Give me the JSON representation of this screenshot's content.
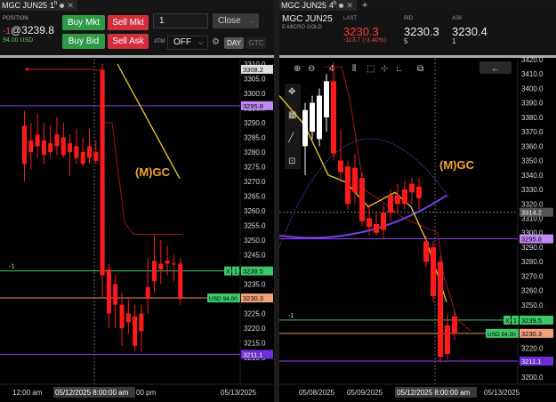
{
  "left": {
    "tab": {
      "symbol": "MGC JUN25",
      "interval": "1",
      "interval_unit": "h"
    },
    "position": {
      "label": "POSITION",
      "qty": "-1",
      "price": "@3239.8",
      "usd": "94.00 USD"
    },
    "buttons": {
      "buy_mkt": "Buy Mkt",
      "sell_mkt": "Sell Mkt",
      "buy_bid": "Buy Bid",
      "sell_ask": "Sell Ask",
      "close": "Close"
    },
    "quantity": "1",
    "atm_label": "ATM",
    "atm_value": "OFF",
    "tif_day": "DAY",
    "tif_gtc": "GTC",
    "watermark": "(M)GC",
    "price_ticks": [
      "3310.0",
      "3305.0",
      "3300.0",
      "3295.0",
      "3290.0",
      "3285.0",
      "3280.0",
      "3275.0",
      "3270.0",
      "3265.0",
      "3260.0",
      "3255.0",
      "3250.0",
      "3245.0",
      "3240.0",
      "3235.0",
      "3230.0",
      "3225.0",
      "3220.0",
      "3215.0",
      "3210.0"
    ],
    "tags": {
      "top_red": "3308.2",
      "purple_top": "3295.8",
      "green": "3239.5",
      "green_qty": "1",
      "green_x": "X",
      "orange": "3230.3",
      "usd_pl": "USD 94.00",
      "purple_bottom": "3211.1",
      "pos_marker": "-1"
    },
    "time_labels": {
      "start": "12:00 am",
      "cursor": "05/12/2025 8:00:00 am",
      "cursor_tail": "00 pm",
      "end": "05/13/2025"
    }
  },
  "right": {
    "tab": {
      "symbol": "MGC JUN25",
      "interval": "4",
      "interval_unit": "h"
    },
    "quote": {
      "symbol": "MGC JUN25",
      "description": "E-MICRO GOLD",
      "last_label": "LAST",
      "last": "3230.3",
      "change": "-113.7 (-3.40%)",
      "bid_label": "BID",
      "bid": "3230.3",
      "bid_size": "5",
      "ask_label": "ASK",
      "ask": "3230.4",
      "ask_size": "1"
    },
    "toolbar_interval": "4",
    "watermark": "(M)GC",
    "price_ticks": [
      "3420.0",
      "3410.0",
      "3400.0",
      "3390.0",
      "3380.0",
      "3370.0",
      "3360.0",
      "3350.0",
      "3340.0",
      "3330.0",
      "3320.0",
      "3310.0",
      "3300.0",
      "3290.0",
      "3280.0",
      "3270.0",
      "3260.0",
      "3250.0",
      "3240.0",
      "3230.0",
      "3220.0",
      "3210.0",
      "3200.0"
    ],
    "tags": {
      "gray": "3314.2",
      "purple_top": "3295.8",
      "green": "3239.5",
      "green_qty": "1",
      "green_x": "X",
      "orange": "3230.3",
      "usd_pl": "USD 94.00",
      "purple_bottom": "3211.1",
      "pos_marker": "-1"
    },
    "time_labels": {
      "d1": "05/08/2025",
      "d2": "05/09/2025",
      "cursor": "05/12/2025 8:00:00 am",
      "end": "05/13/2025"
    }
  },
  "colors": {
    "bear": "#ff1a1a",
    "bull": "#ffffff",
    "yellow_ma": "#f2d21b",
    "purple": "#8b3ff0",
    "green_line": "#3cc96a",
    "orange_line": "#f08a5d",
    "red_line": "#e84848"
  },
  "chart_data": [
    {
      "type": "candlestick",
      "title": "MGC JUN25 1h",
      "ylim": [
        3207,
        3312
      ],
      "candles": [
        {
          "o": 3289,
          "h": 3294,
          "l": 3270,
          "c": 3276
        },
        {
          "o": 3280,
          "h": 3290,
          "l": 3274,
          "c": 3284
        },
        {
          "o": 3286,
          "h": 3293,
          "l": 3278,
          "c": 3282
        },
        {
          "o": 3284,
          "h": 3290,
          "l": 3276,
          "c": 3279
        },
        {
          "o": 3283,
          "h": 3289,
          "l": 3278,
          "c": 3280
        },
        {
          "o": 3286,
          "h": 3292,
          "l": 3279,
          "c": 3282
        },
        {
          "o": 3285,
          "h": 3290,
          "l": 3278,
          "c": 3279
        },
        {
          "o": 3283,
          "h": 3286,
          "l": 3272,
          "c": 3280
        },
        {
          "o": 3282,
          "h": 3288,
          "l": 3276,
          "c": 3278
        },
        {
          "o": 3280,
          "h": 3285,
          "l": 3275,
          "c": 3276
        },
        {
          "o": 3282,
          "h": 3288,
          "l": 3276,
          "c": 3278
        },
        {
          "o": 3280,
          "h": 3284,
          "l": 3276,
          "c": 3277
        },
        {
          "o": 3308,
          "h": 3310,
          "l": 3230,
          "c": 3238
        },
        {
          "o": 3240,
          "h": 3242,
          "l": 3220,
          "c": 3225
        },
        {
          "o": 3235,
          "h": 3238,
          "l": 3220,
          "c": 3228
        },
        {
          "o": 3228,
          "h": 3232,
          "l": 3214,
          "c": 3220
        },
        {
          "o": 3225,
          "h": 3230,
          "l": 3218,
          "c": 3222
        },
        {
          "o": 3224,
          "h": 3228,
          "l": 3212,
          "c": 3214
        },
        {
          "o": 3219,
          "h": 3228,
          "l": 3212,
          "c": 3225
        },
        {
          "o": 3230,
          "h": 3244,
          "l": 3225,
          "c": 3234
        },
        {
          "o": 3236,
          "h": 3252,
          "l": 3232,
          "c": 3243
        },
        {
          "o": 3240,
          "h": 3250,
          "l": 3235,
          "c": 3242
        },
        {
          "o": 3243,
          "h": 3248,
          "l": 3238,
          "c": 3242
        },
        {
          "o": 3242,
          "h": 3245,
          "l": 3236,
          "c": 3242
        },
        {
          "o": 3242,
          "h": 3244,
          "l": 3228,
          "c": 3230
        }
      ],
      "levels": {
        "red_top": 3308.2,
        "purple_top": 3295.8,
        "green": 3239.5,
        "orange": 3230.3,
        "purple_bottom": 3211.1
      }
    },
    {
      "type": "candlestick",
      "title": "MGC JUN25 4h",
      "ylim": [
        3198,
        3422
      ],
      "candles": [
        {
          "o": 3360,
          "h": 3390,
          "l": 3340,
          "c": 3385,
          "bull": true
        },
        {
          "o": 3370,
          "h": 3395,
          "l": 3365,
          "c": 3390,
          "bull": true
        },
        {
          "o": 3365,
          "h": 3400,
          "l": 3360,
          "c": 3395,
          "bull": true
        },
        {
          "o": 3380,
          "h": 3410,
          "l": 3370,
          "c": 3405,
          "bull": true
        },
        {
          "o": 3405,
          "h": 3418,
          "l": 3350,
          "c": 3355
        },
        {
          "o": 3350,
          "h": 3372,
          "l": 3335,
          "c": 3342
        },
        {
          "o": 3346,
          "h": 3350,
          "l": 3316,
          "c": 3320
        },
        {
          "o": 3345,
          "h": 3355,
          "l": 3320,
          "c": 3328
        },
        {
          "o": 3338,
          "h": 3342,
          "l": 3305,
          "c": 3308
        },
        {
          "o": 3310,
          "h": 3320,
          "l": 3298,
          "c": 3304
        },
        {
          "o": 3306,
          "h": 3315,
          "l": 3298,
          "c": 3300
        },
        {
          "o": 3302,
          "h": 3320,
          "l": 3296,
          "c": 3314
        },
        {
          "o": 3314,
          "h": 3330,
          "l": 3308,
          "c": 3326
        },
        {
          "o": 3326,
          "h": 3334,
          "l": 3314,
          "c": 3320
        },
        {
          "o": 3320,
          "h": 3336,
          "l": 3316,
          "c": 3330
        },
        {
          "o": 3328,
          "h": 3338,
          "l": 3320,
          "c": 3334
        },
        {
          "o": 3332,
          "h": 3338,
          "l": 3316,
          "c": 3324
        },
        {
          "o": 3294,
          "h": 3298,
          "l": 3276,
          "c": 3280
        },
        {
          "o": 3290,
          "h": 3294,
          "l": 3252,
          "c": 3256
        },
        {
          "o": 3280,
          "h": 3284,
          "l": 3210,
          "c": 3214
        },
        {
          "o": 3236,
          "h": 3244,
          "l": 3212,
          "c": 3216
        },
        {
          "o": 3242,
          "h": 3246,
          "l": 3226,
          "c": 3230
        }
      ],
      "levels": {
        "gray": 3314.2,
        "purple_top": 3295.8,
        "green": 3239.5,
        "orange": 3230.3,
        "purple_bottom": 3211.1
      }
    }
  ]
}
